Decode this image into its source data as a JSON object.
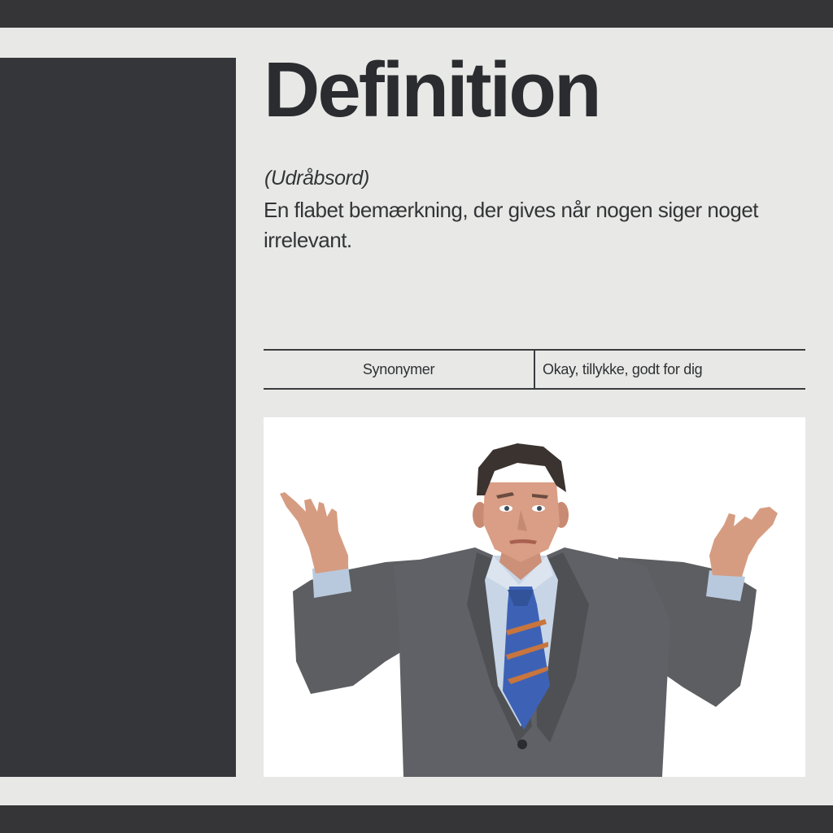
{
  "entry": {
    "title": "Definition",
    "word_class": "(Udråbsord)",
    "definition": "En flabet bemærkning, der gives når nogen siger noget irrelevant."
  },
  "synonyms": {
    "label": "Synonymer",
    "value": "Okay, tillykke, godt for dig"
  },
  "image": {
    "subject": "shrugging-man-in-suit"
  },
  "colors": {
    "background": "#e8e9e7",
    "dark_panel": "#353639",
    "text": "#2f3033",
    "photo_background": "#ffffff"
  }
}
